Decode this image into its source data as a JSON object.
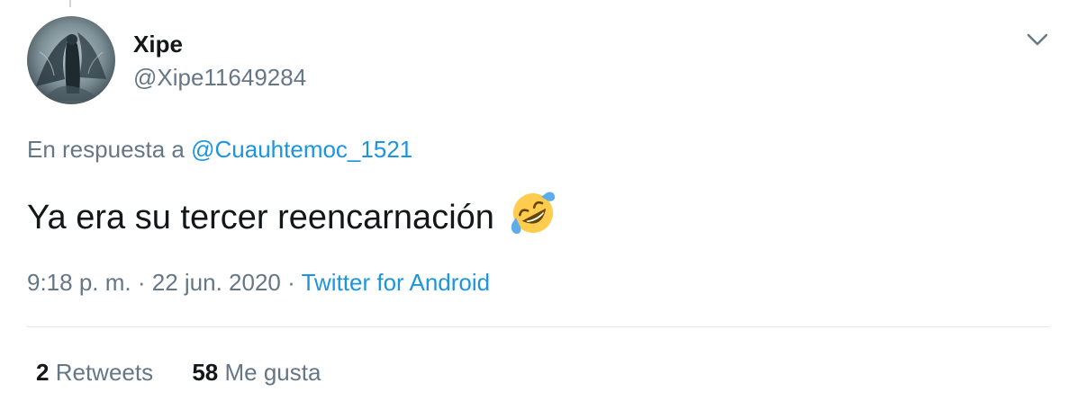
{
  "tweet": {
    "user": {
      "display_name": "Xipe",
      "handle": "@Xipe11649284",
      "avatar_icon": "dark-winged-angel-avatar"
    },
    "menu_icon": "chevron-down-icon",
    "reply_prefix": "En respuesta a",
    "reply_to": "@Cuauhtemoc_1521",
    "text": "Ya era su tercer reencarnación",
    "emoji_icon": "rolling-on-floor-laughing-emoji",
    "time": "9:18 p. m.",
    "separator": "·",
    "date": "22 jun. 2020",
    "source": "Twitter for Android",
    "stats": {
      "retweets_count": "2",
      "retweets_label": "Retweets",
      "likes_count": "58",
      "likes_label": "Me gusta"
    },
    "colors": {
      "text": "#14171a",
      "secondary": "#657786",
      "link": "#1b95e0",
      "divider": "#e1e8ed"
    }
  }
}
